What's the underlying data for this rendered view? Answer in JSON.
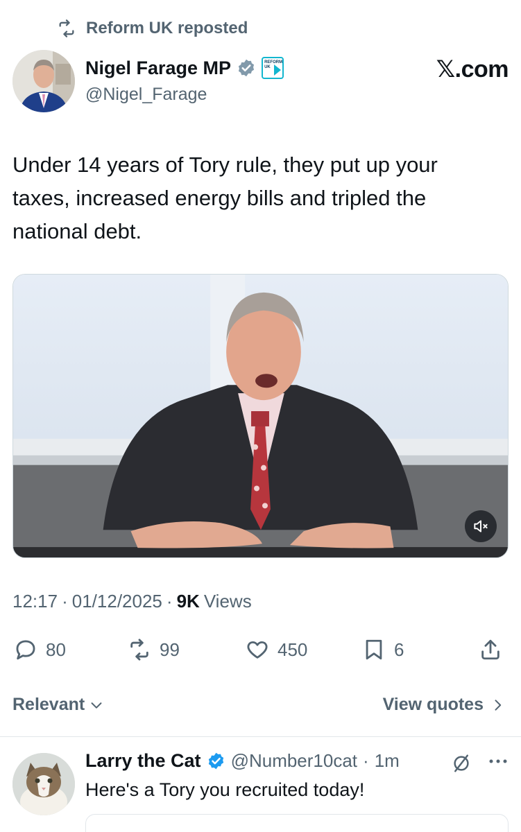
{
  "repost": {
    "label": "Reform UK reposted"
  },
  "author": {
    "name": "Nigel Farage MP",
    "handle": "@Nigel_Farage",
    "badge_text": "REFORM UK"
  },
  "watermark": "𝕏.com",
  "tweet": {
    "text": "Under 14 years of Tory rule, they put up your taxes, increased energy bills and tripled the national debt."
  },
  "meta": {
    "time": "12:17",
    "sep1": "·",
    "date": "01/12/2025",
    "sep2": "·",
    "views_count": "9K",
    "views_label": "Views"
  },
  "actions": {
    "replies": "80",
    "reposts": "99",
    "likes": "450",
    "bookmarks": "6"
  },
  "sort": {
    "relevant": "Relevant",
    "view_quotes": "View quotes"
  },
  "reply": {
    "name": "Larry the Cat",
    "handle": "@Number10cat",
    "sep": "·",
    "time": "1m",
    "text": "Here's a Tory you recruited today!"
  },
  "colors": {
    "secondary_text": "#536471",
    "primary_text": "#0f1419",
    "verified": "#829aab",
    "reply_verified": "#1d9bf0",
    "reform_teal": "#12b6cf"
  }
}
